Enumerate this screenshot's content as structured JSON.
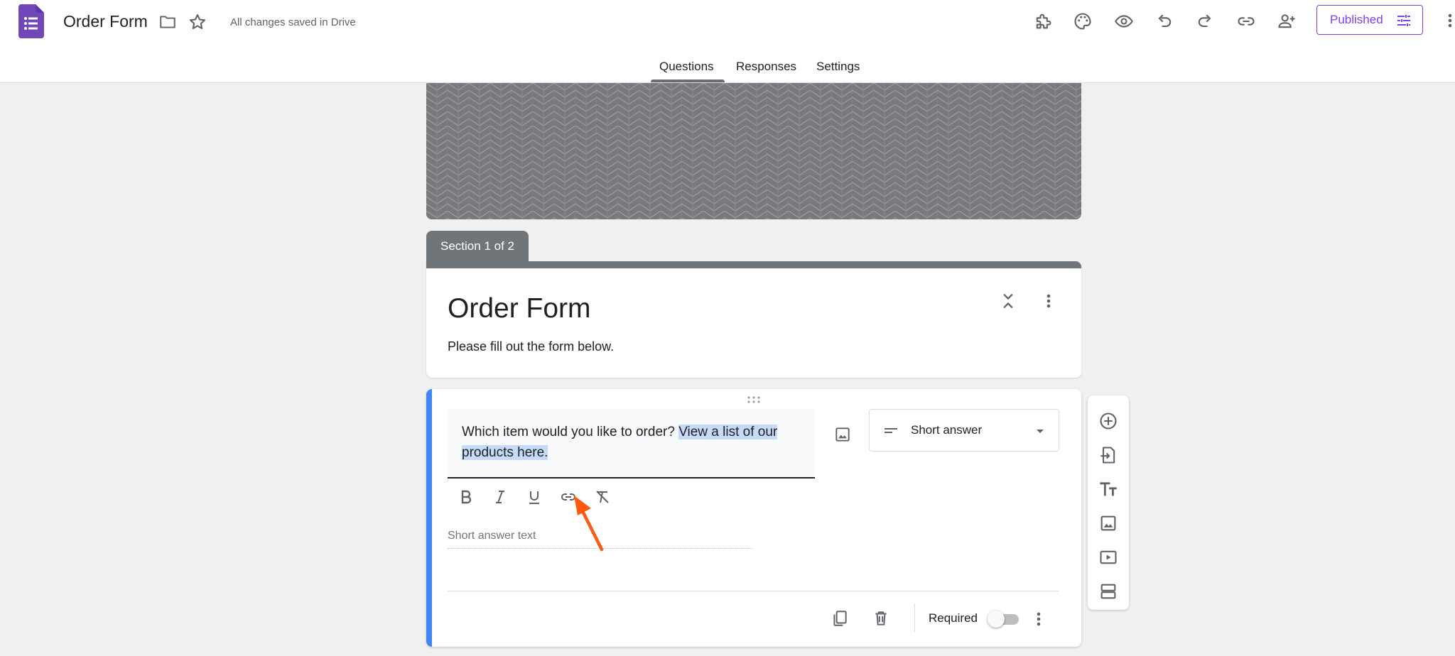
{
  "app": {
    "title": "Order Form",
    "save_status": "All changes saved in Drive",
    "published_label": "Published"
  },
  "tabs": [
    {
      "label": "Questions",
      "active": true
    },
    {
      "label": "Responses",
      "active": false
    },
    {
      "label": "Settings",
      "active": false
    }
  ],
  "toolbar_icons": [
    "addons-icon",
    "palette-icon",
    "preview-icon",
    "undo-icon",
    "redo-icon",
    "link-icon",
    "add-collaborator-icon"
  ],
  "section": {
    "label": "Section 1 of 2",
    "title": "Order Form",
    "description": "Please fill out the form below."
  },
  "question": {
    "text_plain": "Which item would you like to order? ",
    "text_selected": "View a list of our products here.",
    "type_label": "Short answer",
    "answer_placeholder": "Short answer text",
    "required_label": "Required",
    "required": false
  },
  "colors": {
    "accent": "#7e3ff2",
    "active_card": "#4285f4",
    "section_header": "#70757a",
    "selection": "#c6dbf7",
    "annotation": "#ff5a0f"
  }
}
